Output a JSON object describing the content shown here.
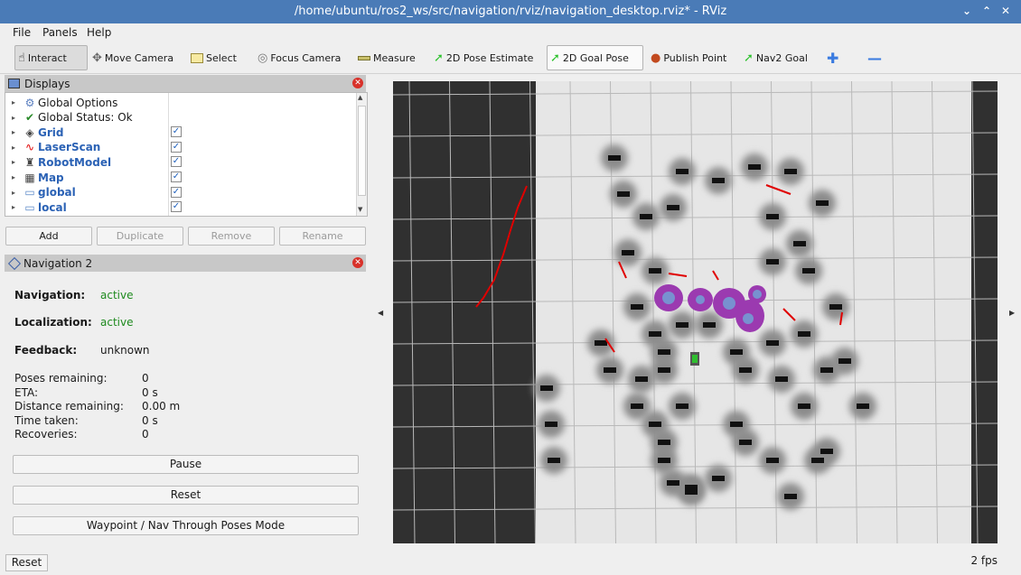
{
  "window": {
    "title": "/home/ubuntu/ros2_ws/src/navigation/rviz/navigation_desktop.rviz* - RViz"
  },
  "menu": [
    "File",
    "Panels",
    "Help"
  ],
  "toolbar": {
    "interact": "Interact",
    "move_camera": "Move Camera",
    "select": "Select",
    "focus_camera": "Focus Camera",
    "measure": "Measure",
    "pose_estimate": "2D Pose Estimate",
    "goal_pose": "2D Goal Pose",
    "publish_point": "Publish Point",
    "nav2_goal": "Nav2 Goal"
  },
  "displays": {
    "title": "Displays",
    "items": [
      {
        "label": "Global Options",
        "icon": "gear-icon",
        "checked": false,
        "blue": false
      },
      {
        "label": "Global Status: Ok",
        "icon": "checkmark-icon",
        "checked": false,
        "blue": false
      },
      {
        "label": "Grid",
        "icon": "grid-icon",
        "checked": true,
        "blue": true
      },
      {
        "label": "LaserScan",
        "icon": "laserscan-icon",
        "checked": true,
        "blue": true
      },
      {
        "label": "RobotModel",
        "icon": "robot-icon",
        "checked": true,
        "blue": true
      },
      {
        "label": "Map",
        "icon": "map-icon",
        "checked": true,
        "blue": true
      },
      {
        "label": "global",
        "icon": "folder-icon",
        "checked": true,
        "blue": true
      },
      {
        "label": "local",
        "icon": "folder-icon",
        "checked": true,
        "blue": true
      }
    ],
    "buttons": {
      "add": "Add",
      "duplicate": "Duplicate",
      "remove": "Remove",
      "rename": "Rename"
    }
  },
  "navigation": {
    "title": "Navigation 2",
    "navigation_label": "Navigation:",
    "navigation_value": "active",
    "localization_label": "Localization:",
    "localization_value": "active",
    "feedback_label": "Feedback:",
    "feedback_value": "unknown",
    "poses_remaining_label": "Poses remaining:",
    "poses_remaining": "0",
    "eta_label": "ETA:",
    "eta": "0 s",
    "distance_label": "Distance remaining:",
    "distance": "0.00 m",
    "time_label": "Time taken:",
    "time": "0 s",
    "recoveries_label": "Recoveries:",
    "recoveries": "0",
    "pause": "Pause",
    "reset": "Reset",
    "waypoint_mode": "Waypoint / Nav Through Poses Mode"
  },
  "status": {
    "reset": "Reset",
    "fps": "2 fps"
  },
  "colors": {
    "titlebar": "#4a7bb7",
    "active_green": "#1e8a1e",
    "display_blue": "#2b62b5",
    "laser_red": "#e00000",
    "costmap_purple": "#9b3ab0"
  }
}
